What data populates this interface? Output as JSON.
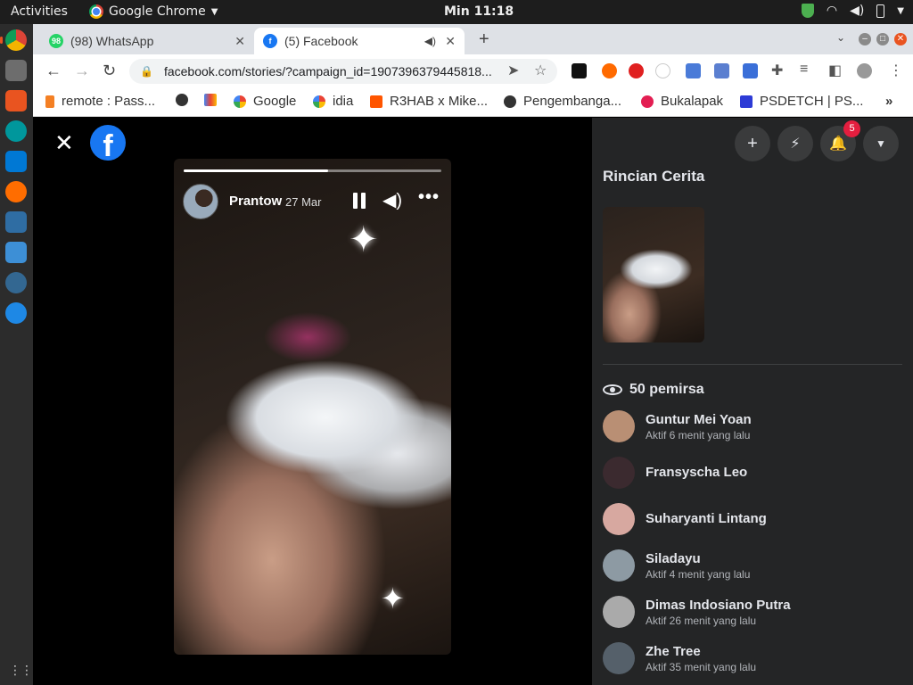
{
  "system_bar": {
    "activities": "Activities",
    "app_name": "Google Chrome",
    "clock": "Min 11:18"
  },
  "browser": {
    "tabs": [
      {
        "label": "(98) WhatsApp",
        "icon": "whatsapp-icon",
        "badge": "98",
        "active": false
      },
      {
        "label": "(5) Facebook",
        "icon": "facebook-icon",
        "active": true,
        "audio": true
      }
    ],
    "url": "facebook.com/stories/?campaign_id=1907396379445818...",
    "bookmarks": [
      {
        "label": "remote : Pass...",
        "icon": "stackoverflow-icon"
      },
      {
        "label": "",
        "icon": "globe-icon"
      },
      {
        "label": "",
        "icon": "gmail-icon"
      },
      {
        "label": "Google",
        "icon": "google-icon"
      },
      {
        "label": "idia",
        "icon": "google-icon"
      },
      {
        "label": "R3HAB x Mike...",
        "icon": "soundcloud-icon"
      },
      {
        "label": "Pengembanga...",
        "icon": "globe-icon"
      },
      {
        "label": "Bukalapak",
        "icon": "bukalapak-icon"
      },
      {
        "label": "PSDETCH | PS...",
        "icon": "psdetch-icon"
      }
    ],
    "overflow": "»"
  },
  "story": {
    "author": "Prantow",
    "date": "27 Mar",
    "progress": 0.56,
    "more": "•••"
  },
  "panel": {
    "title": "Rincian Cerita",
    "notification_count": "5",
    "viewer_count": "50 pemirsa",
    "viewers": [
      {
        "name": "Guntur Mei Yoan",
        "status": "Aktif 6 menit yang lalu",
        "color": "#b98f74"
      },
      {
        "name": "Fransyscha Leo",
        "status": "",
        "color": "#3b2a2f"
      },
      {
        "name": "Suharyanti Lintang",
        "status": "",
        "color": "#d7a8a0"
      },
      {
        "name": "Siladayu",
        "status": "Aktif 4 menit yang lalu",
        "color": "#8d9aa3"
      },
      {
        "name": "Dimas Indosiano Putra",
        "status": "Aktif 26 menit yang lalu",
        "color": "#aaaaaa"
      },
      {
        "name": "Zhe Tree",
        "status": "Aktif 35 menit yang lalu",
        "color": "#55606a"
      }
    ]
  }
}
